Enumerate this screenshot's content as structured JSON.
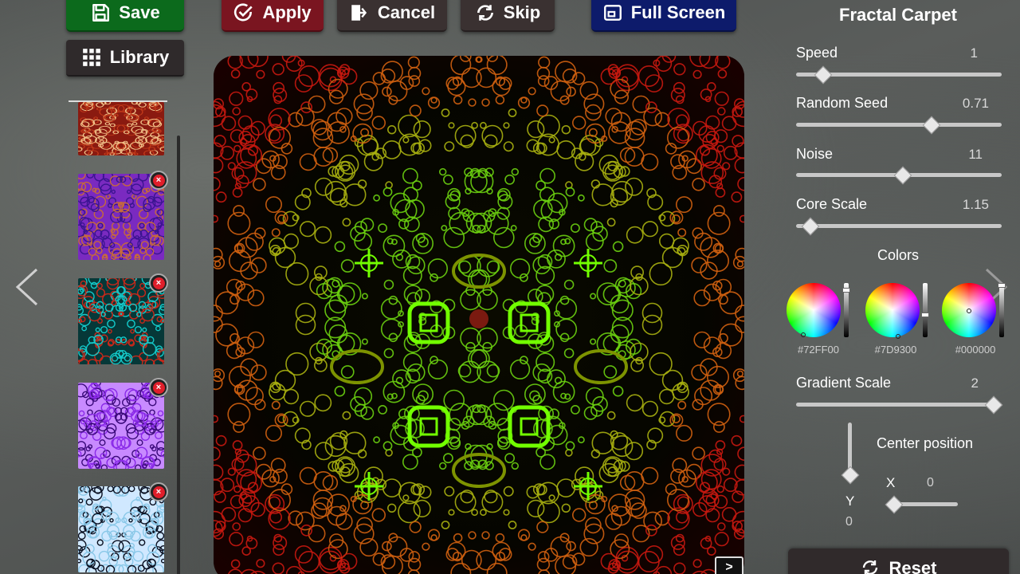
{
  "toolbar": {
    "save_label": "Save",
    "apply_label": "Apply",
    "cancel_label": "Cancel",
    "skip_label": "Skip",
    "fullscreen_label": "Full Screen",
    "library_label": "Library"
  },
  "library": {
    "thumbnails": [
      {
        "name": "warm-orange-pattern",
        "colors": [
          "#c33a1a",
          "#f2c48a",
          "#8a1a10"
        ]
      },
      {
        "name": "purple-orange-pattern",
        "colors": [
          "#3a1490",
          "#c66a3a",
          "#7a2ac0"
        ]
      },
      {
        "name": "cyan-red-mandala",
        "colors": [
          "#14c8c8",
          "#c8281a",
          "#063838"
        ]
      },
      {
        "name": "violet-mandala",
        "colors": [
          "#8a2ae8",
          "#3a0a7a",
          "#c88aff"
        ]
      },
      {
        "name": "icy-blue-pattern",
        "colors": [
          "#8ac8e8",
          "#0a1020",
          "#d0e8ff"
        ]
      }
    ]
  },
  "canvas": {
    "toggle_label": ">"
  },
  "panel": {
    "title": "Fractal Carpet",
    "params": [
      {
        "label": "Speed",
        "value": "1",
        "fraction": 0.13
      },
      {
        "label": "Random Seed",
        "value": "0.71",
        "fraction": 0.66
      },
      {
        "label": "Noise",
        "value": "11",
        "fraction": 0.52
      },
      {
        "label": "Core Scale",
        "value": "1.15",
        "fraction": 0.07
      }
    ],
    "colors_label": "Colors",
    "colors": [
      {
        "hex": "#72FF00",
        "brightness": 0.1
      },
      {
        "hex": "#7D9300",
        "brightness": 0.6
      },
      {
        "hex": "#000000",
        "brightness": 0.0
      }
    ],
    "gradient": {
      "label": "Gradient Scale",
      "value": "2",
      "fraction": 0.96
    },
    "center": {
      "label": "Center position",
      "x_label": "X",
      "x_value": "0",
      "y_label": "Y",
      "y_value": "0"
    },
    "reset_label": "Reset"
  }
}
